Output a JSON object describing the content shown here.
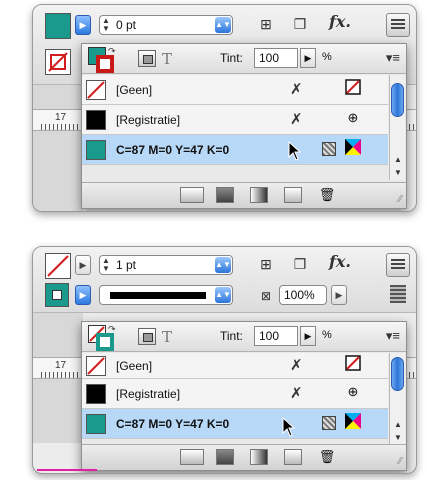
{
  "colors": {
    "teal": "#1a9a8c",
    "registration": "#000000",
    "none_red": "#d21f1f",
    "selection": "#b8d8f8",
    "accent_blue": "#2d7ae0"
  },
  "screen1": {
    "toolbar": {
      "stroke_weight": "0 pt",
      "fx_label": "fx."
    },
    "ruler_number": "17",
    "panel": {
      "tint_label": "Tint:",
      "tint_value": "100",
      "percent": "%",
      "swatches": [
        {
          "name": "[Geen]",
          "icon1": "no-edit-icon",
          "icon2": "none-swatch-icon"
        },
        {
          "name": "[Registratie]",
          "icon1": "no-edit-icon",
          "icon2": "registration-target-icon"
        },
        {
          "name": "C=87 M=0 Y=47 K=0",
          "icon1": "",
          "icon2": "cmyk-process-icon"
        }
      ]
    }
  },
  "screen2": {
    "toolbar": {
      "stroke_weight": "1 pt",
      "zoom": "100%",
      "fx_label": "fx."
    },
    "ruler_number": "17",
    "panel": {
      "tint_label": "Tint:",
      "tint_value": "100",
      "percent": "%",
      "swatches": [
        {
          "name": "[Geen]",
          "icon1": "no-edit-icon",
          "icon2": "none-swatch-icon"
        },
        {
          "name": "[Registratie]",
          "icon1": "no-edit-icon",
          "icon2": "registration-target-icon"
        },
        {
          "name": "C=87 M=0 Y=47 K=0",
          "icon1": "",
          "icon2": "cmyk-process-icon"
        }
      ]
    }
  }
}
